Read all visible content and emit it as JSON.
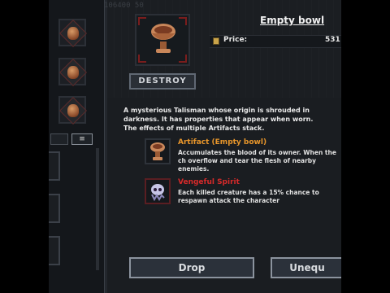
{
  "header": {
    "bg_numbers": "106400     50"
  },
  "item": {
    "title": "Empty bowl",
    "price_label": "Price:",
    "price_value": "531",
    "destroy_label": "DESTROY",
    "icon": "bowl-icon"
  },
  "description": {
    "intro": "A mysterious Talisman whose origin is shrouded in darkness. It has properties that appear when worn.",
    "stack_note": "The effects of multiple Artifacts stack."
  },
  "effects": [
    {
      "title": "Artifact (Empty bowl)",
      "text": "Accumulates the blood of its owner. When the ch overflow and tear the flesh of nearby enemies.",
      "color": "#e8962b",
      "icon": "bowl-icon"
    },
    {
      "title": "Vengeful Spirit",
      "text": "Each killed creature has a 15% chance to respawn attack the character",
      "color": "#d62a2a",
      "icon": "ghost-skull-icon"
    }
  ],
  "inventory_slots": [
    "bowl-icon",
    "bowl-icon",
    "bowl-icon"
  ],
  "sort_button_label": "≡",
  "buttons": {
    "drop": "Drop",
    "unequip": "Unequ"
  },
  "colors": {
    "artifact": "#e8962b",
    "curse": "#d62a2a",
    "panel": "#1a1d21"
  }
}
